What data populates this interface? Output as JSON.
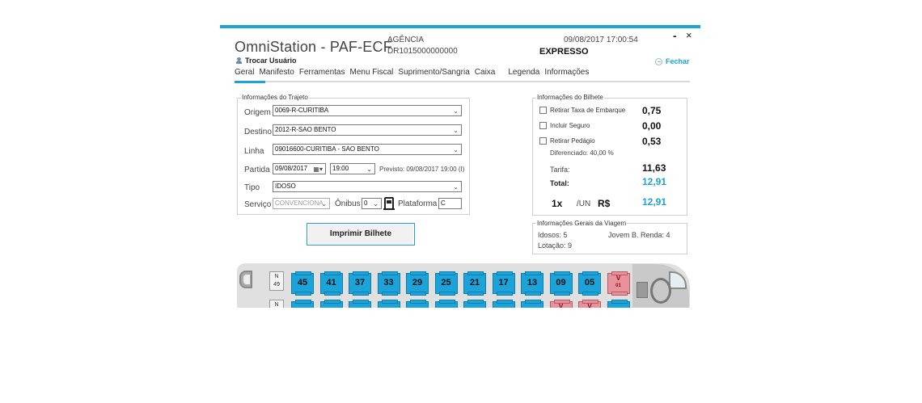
{
  "window": {
    "title": "OmniStation - PAF-ECF",
    "agency_label": "AGÊNCIA",
    "agency_value": "DR1015000000000",
    "datetime": "09/08/2017 17:00:54",
    "company": "EXPRESSO",
    "minimize": "-",
    "close": "×",
    "switch_user": "Trocar Usuário",
    "close_link": "Fechar",
    "accent": "#1ca3d9"
  },
  "menu": [
    "Geral",
    "Manifesto",
    "Ferramentas",
    "Menu Fiscal",
    "Suprimento/Sangria",
    "Caixa",
    "Legenda",
    "Informações"
  ],
  "trip": {
    "group_title": "Informações do Trajeto",
    "origem_label": "Origem",
    "origem_value": "0069-R-CURITIBA",
    "destino_label": "Destino",
    "destino_value": "2012-R-SAO BENTO",
    "linha_label": "Linha",
    "linha_value": "09016600-CURITIBA  - SAO BENTO",
    "partida_label": "Partida",
    "partida_date": "09/08/2017",
    "partida_time": "19:00",
    "previsto": "Previsto: 09/08/2017 19:00 (I)",
    "tipo_label": "Tipo",
    "tipo_value": "IDOSO",
    "servico_label": "Serviço",
    "servico_value": "CONVENCIONA",
    "onibus_label": "Ônibus",
    "onibus_value": "0",
    "plataforma_label": "Plataforma",
    "plataforma_value": "C"
  },
  "print_button": "Imprimir Bilhete",
  "ticket": {
    "group_title": "Informações do Bilhete",
    "retirar_taxa": "Retirar Taxa de Embarque",
    "taxa_value": "0,75",
    "incluir_seguro": "Incluir Seguro",
    "seguro_value": "0,00",
    "retirar_pedagio": "Retirar Pedágio",
    "pedagio_value": "0,53",
    "diferenciado": "Diferenciado: 40,00 %",
    "tarifa_label": "Tarifa:",
    "tarifa_value": "11,63",
    "total_label": "Total:",
    "total_value": "12,91",
    "qty": "1x",
    "unit": "/UN",
    "currency": "R$",
    "final_value": "12,91"
  },
  "trip_info": {
    "group_title": "Informações Gerais da Viagem",
    "idosos": "Idosos: 5",
    "jovem": "Jovem B. Renda: 4",
    "lotacao": "Lotação: 9"
  },
  "seats_row1": [
    {
      "label": "45",
      "status": "free"
    },
    {
      "label": "41",
      "status": "free"
    },
    {
      "label": "37",
      "status": "free"
    },
    {
      "label": "33",
      "status": "free"
    },
    {
      "label": "29",
      "status": "free"
    },
    {
      "label": "25",
      "status": "free"
    },
    {
      "label": "21",
      "status": "free"
    },
    {
      "label": "17",
      "status": "free"
    },
    {
      "label": "13",
      "status": "free"
    },
    {
      "label": "09",
      "status": "free"
    },
    {
      "label": "05",
      "status": "free"
    },
    {
      "label": "V",
      "sub": "01",
      "status": "reserved"
    }
  ],
  "seat_n": {
    "top": "N",
    "bottom": "49"
  },
  "seat_n2": {
    "top": "N"
  },
  "seats_row2_status": [
    "free",
    "free",
    "free",
    "free",
    "free",
    "free",
    "free",
    "free",
    "free",
    "reserved",
    "reserved",
    "free"
  ],
  "seats_row2_labels": [
    "",
    "",
    "",
    "",
    "",
    "",
    "",
    "",
    "",
    "V",
    "V",
    ""
  ]
}
